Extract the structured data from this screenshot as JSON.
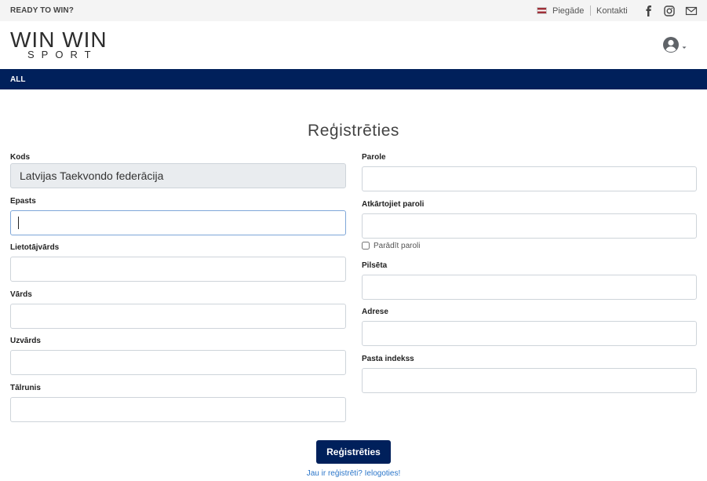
{
  "topbar": {
    "tagline": "READY TO WIN?",
    "delivery": "Piegāde",
    "contacts": "Kontakti",
    "icons": [
      "facebook-icon",
      "instagram-icon",
      "mail-icon"
    ]
  },
  "header": {
    "logo_line1": "WIN WIN",
    "logo_line2": "SPORT",
    "account_icon": "user-circle-icon"
  },
  "nav": {
    "all": "ALL"
  },
  "form": {
    "title": "Reģistrēties",
    "left": [
      {
        "label": "Kods",
        "value": "Latvijas Taekvondo federācija"
      },
      {
        "label": "Epasts",
        "value": ""
      },
      {
        "label": "Lietotājvārds",
        "value": ""
      },
      {
        "label": "Vārds",
        "value": ""
      },
      {
        "label": "Uzvārds",
        "value": ""
      },
      {
        "label": "Tālrunis",
        "value": ""
      }
    ],
    "right": [
      {
        "label": "Parole",
        "value": ""
      },
      {
        "label": "Atkārtojiet paroli",
        "value": ""
      },
      {
        "label": "Pilsēta",
        "value": ""
      },
      {
        "label": "Adrese",
        "value": ""
      },
      {
        "label": "Pasta indekss",
        "value": ""
      }
    ],
    "show_password": "Parādīt paroli",
    "submit": "Reģistrēties",
    "login_link": "Jau ir reģistrēti? Ielogoties!"
  },
  "colors": {
    "primary": "#00205b",
    "link": "#2a75c9"
  }
}
